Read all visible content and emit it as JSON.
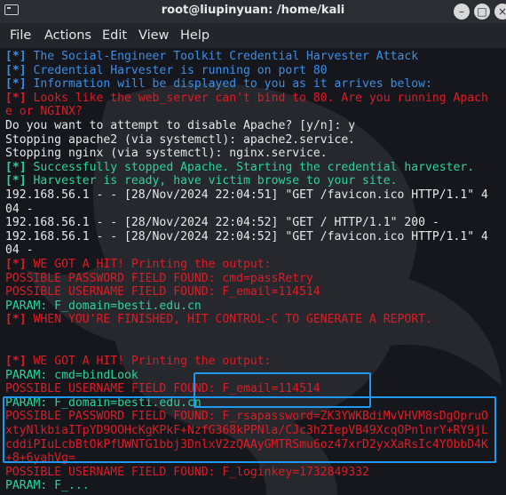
{
  "window": {
    "title": "root@liupinyuan: /home/kali",
    "buttons": [
      "–",
      "□",
      "×"
    ]
  },
  "menu": [
    "File",
    "Actions",
    "Edit",
    "View",
    "Help"
  ],
  "colors": {
    "info_blue": "#3a8ee8",
    "alert_red": "#e01b24",
    "success_green": "#2bd39a",
    "highlight_box": "#1e98f0"
  },
  "terminal": {
    "lines": [
      {
        "prefix": "[*]",
        "text": " The Social-Engineer Toolkit Credential Harvester Attack",
        "color": "blue"
      },
      {
        "prefix": "[*]",
        "text": " Credential Harvester is running on port 80",
        "color": "blue"
      },
      {
        "prefix": "[*]",
        "text": " Information will be displayed to you as it arrives below:",
        "color": "blue"
      },
      {
        "prefix": "[*]",
        "text": " Looks like the web_server can't bind to 80. Are you running Apach",
        "color": "red"
      },
      {
        "prefix": "",
        "text": "e or NGINX?",
        "color": "red"
      },
      {
        "prefix": "",
        "text": "Do you want to attempt to disable Apache? [y/n]: y",
        "color": "white"
      },
      {
        "prefix": "",
        "text": "Stopping apache2 (via systemctl): apache2.service.",
        "color": "white"
      },
      {
        "prefix": "",
        "text": "Stopping nginx (via systemctl): nginx.service.",
        "color": "white"
      },
      {
        "prefix": "[*]",
        "text": " Successfully stopped Apache. Starting the credential harvester.",
        "color": "green"
      },
      {
        "prefix": "[*]",
        "text": " Harvester is ready, have victim browse to your site.",
        "color": "green"
      },
      {
        "prefix": "",
        "text": "192.168.56.1 - - [28/Nov/2024 22:04:51] \"GET /favicon.ico HTTP/1.1\" 4",
        "color": "white"
      },
      {
        "prefix": "",
        "text": "04 -",
        "color": "white"
      },
      {
        "prefix": "",
        "text": "192.168.56.1 - - [28/Nov/2024 22:04:52] \"GET / HTTP/1.1\" 200 -",
        "color": "white"
      },
      {
        "prefix": "",
        "text": "192.168.56.1 - - [28/Nov/2024 22:04:52] \"GET /favicon.ico HTTP/1.1\" 4",
        "color": "white"
      },
      {
        "prefix": "",
        "text": "04 -",
        "color": "white"
      },
      {
        "prefix": "[*]",
        "text": " WE GOT A HIT! Printing the output:",
        "color": "red"
      },
      {
        "prefix": "",
        "text": "POSSIBLE PASSWORD FIELD FOUND: cmd=passRetry",
        "color": "red"
      },
      {
        "prefix": "",
        "text": "POSSIBLE USERNAME FIELD FOUND: F_email=114514",
        "color": "red"
      },
      {
        "prefix": "",
        "text": "PARAM: F_domain=besti.edu.cn",
        "color": "green"
      },
      {
        "prefix": "[*]",
        "text": " WHEN YOU'RE FINISHED, HIT CONTROL-C TO GENERATE A REPORT.",
        "color": "red"
      },
      {
        "prefix": "",
        "text": "",
        "color": "white"
      },
      {
        "prefix": "",
        "text": "",
        "color": "white"
      },
      {
        "prefix": "[*]",
        "text": " WE GOT A HIT! Printing the output:",
        "color": "red"
      },
      {
        "prefix": "",
        "text": "PARAM: cmd=bindLook",
        "color": "green"
      },
      {
        "prefix": "",
        "text": "POSSIBLE USERNAME FIELD FOUND: F_email=114514",
        "color": "red"
      },
      {
        "prefix": "",
        "text": "PARAM: F_domain=besti.edu.cn",
        "color": "green"
      },
      {
        "prefix": "",
        "text": "POSSIBLE PASSWORD FIELD FOUND: F_rsapassword=ZK3YWKBdiMvVHVM8sDgOpruO",
        "color": "red"
      },
      {
        "prefix": "",
        "text": "xtyNlkbiaITpYD9OOHcKgKPkF+NzfG368kPPNla/CJc3h2IepVB49XcqOPnlnrY+RY9jL",
        "color": "red"
      },
      {
        "prefix": "",
        "text": "cddiPIuLcbBtOkPfUWNTG1bbj3DnlxV2zQAAyGMTRSmu6oz47xrD2yxXaRsIc4YObbD4K",
        "color": "red"
      },
      {
        "prefix": "",
        "text": "+8+6yahVg=",
        "color": "red"
      },
      {
        "prefix": "",
        "text": "POSSIBLE USERNAME FIELD FOUND: F_loginkey=1732849332",
        "color": "red"
      },
      {
        "prefix": "",
        "text": "PARAM: F_...",
        "color": "green"
      }
    ]
  }
}
